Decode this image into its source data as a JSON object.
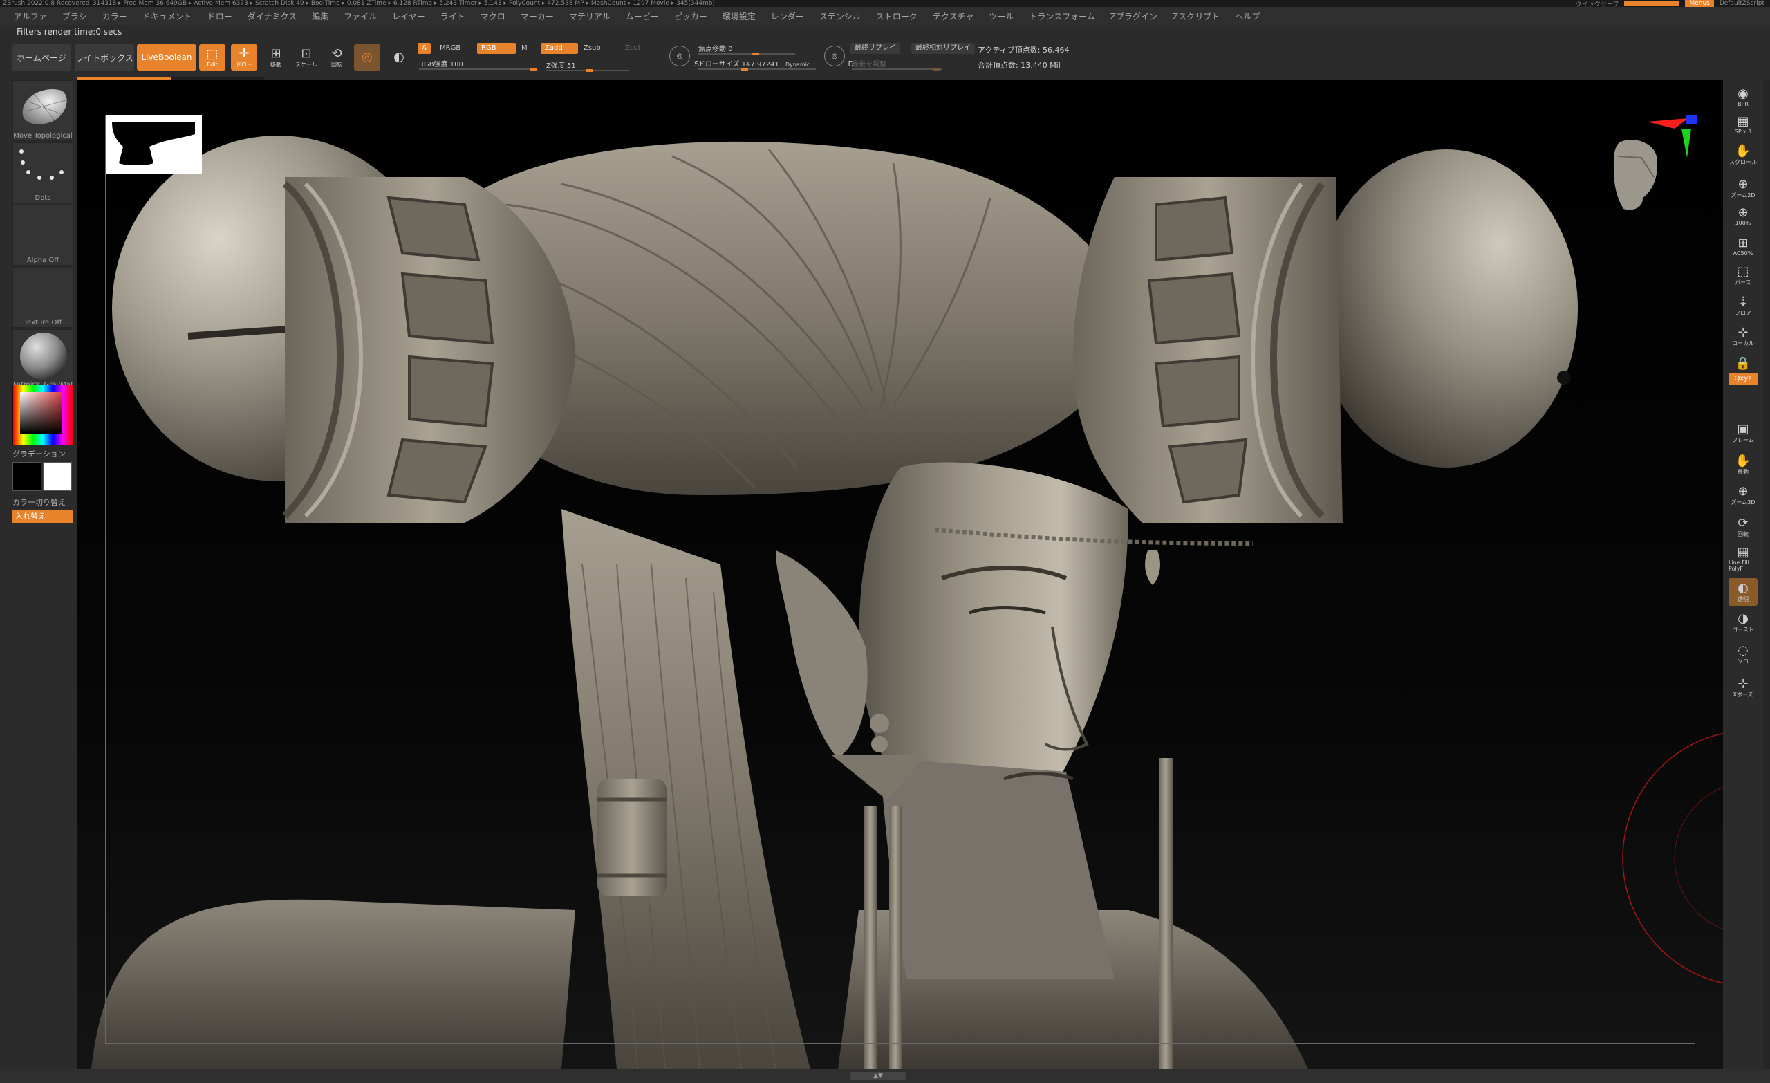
{
  "titlebar": {
    "status": "ZBrush 2022.0.8  Recovered_314318  ▸ Free Mem 36.649GB ▸ Active Mem 6373 ▸ Scratch Disk 49 ▸ BoolTime ▸ 0.081 ZTime ▸ 6.128 RTime ▸ 5.243 Timer ▸ 5.143 ▸ PolyCount ▸ 472.538 MP ▸ MeshCount ▸ 1297 Movie ▸ 345(344mb)",
    "quicksave": "クイックセーブ",
    "menus": "Menus",
    "script": "DefaultZScript"
  },
  "menu": [
    "アルファ",
    "ブラシ",
    "カラー",
    "ドキュメント",
    "ドロー",
    "ダイナミクス",
    "編集",
    "ファイル",
    "レイヤー",
    "ライト",
    "マクロ",
    "マーカー",
    "マテリアル",
    "ムービー",
    "ピッカー",
    "環境設定",
    "レンダー",
    "ステンシル",
    "ストローク",
    "テクスチャ",
    "ツール",
    "トランスフォーム",
    "Zプラグイン",
    "Zスクリプト",
    "ヘルプ"
  ],
  "filters_status": "Filters render time:0 secs",
  "toolbar": {
    "home": "ホームページ",
    "lightbox": "ライトボックス",
    "liveboolean": "LiveBoolean",
    "progress": 0.5,
    "edit_label": "Edit",
    "draw_label": "ドロー",
    "move_label": "移動",
    "scale_label": "スケール",
    "rotate_label": "回転",
    "a_chip": "A",
    "mrgb": "MRGB",
    "rgb": "RGB",
    "m": "M",
    "zadd": "Zadd",
    "zsub": "Zsub",
    "zcut": "Zcut",
    "rgb_intensity": "RGB強度 100",
    "z_intensity": "Z強度 51",
    "focal_shift": "焦点移動 0",
    "draw_size": "ドローサイズ 147.97241",
    "dynamic": "Dynamic",
    "s_label": "S",
    "d_label": "D",
    "replay_last": "最終リプレイ",
    "replay_last_rel": "最終相対リプレイ",
    "adjust_last": "最後を調整",
    "active_points": "アクティブ頂点数: 56,464",
    "total_points": "合計頂点数: 13.440 Mil"
  },
  "left_shelf": {
    "brush": "Move Topological",
    "stroke": "Dots",
    "alpha": "Alpha Off",
    "texture": "Texture Off",
    "material": "Fatmir's_GreyMat",
    "gradient": "グラデーション",
    "switch_color": "カラー切り替え",
    "swap": "入れ替え"
  },
  "right_shelf": [
    {
      "name": "bpr",
      "label": "BPR"
    },
    {
      "name": "spix",
      "label": "SPix 3"
    },
    {
      "name": "scroll",
      "label": "スクロール"
    },
    {
      "name": "zoom2d",
      "label": "ズーム2D"
    },
    {
      "name": "100pct",
      "label": "100%"
    },
    {
      "name": "ac50pct",
      "label": "AC50%"
    },
    {
      "name": "dynamic-perspective",
      "label": "パース"
    },
    {
      "name": "floor",
      "label": "フロア"
    },
    {
      "name": "local",
      "label": "ローカル"
    },
    {
      "name": "lock",
      "label": ""
    },
    {
      "name": "xyz",
      "label": "Qxyz"
    },
    {
      "name": "frame",
      "label": "フレーム"
    },
    {
      "name": "move",
      "label": "移動"
    },
    {
      "name": "zoom3d",
      "label": "ズーム3D"
    },
    {
      "name": "rotate",
      "label": "回転"
    },
    {
      "name": "linefill",
      "label": "Line Fill PolyF"
    },
    {
      "name": "transp",
      "label": "透明"
    },
    {
      "name": "ghost",
      "label": "ゴースト"
    },
    {
      "name": "solo",
      "label": "ソロ"
    },
    {
      "name": "xpose",
      "label": "Xポーズ"
    }
  ],
  "colors": {
    "accent": "#e8822b",
    "panel": "#2b2b2b",
    "clay": "#8c8578"
  }
}
